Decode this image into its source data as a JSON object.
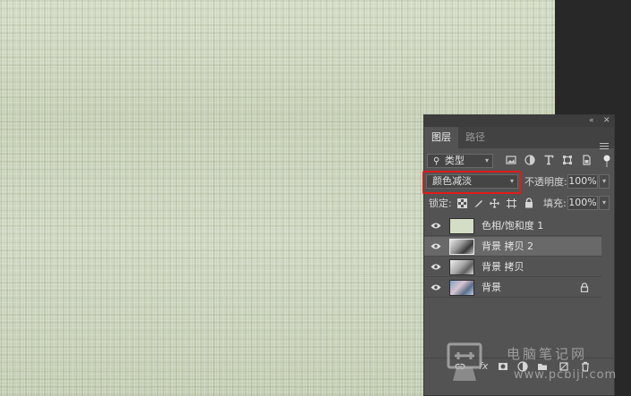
{
  "layers_panel": {
    "tabs": [
      {
        "label": "图层",
        "active": true
      },
      {
        "label": "路径",
        "active": false
      }
    ],
    "filter": {
      "kind_label": "类型"
    },
    "blend_mode": "颜色减淡",
    "opacity": {
      "label": "不透明度:",
      "value": "100%"
    },
    "lock": {
      "label": "锁定:"
    },
    "fill": {
      "label": "填充:",
      "value": "100%"
    },
    "layers": [
      {
        "name": "色相/饱和度 1",
        "visible": true,
        "selected": false,
        "locked": false
      },
      {
        "name": "背景 拷贝 2",
        "visible": true,
        "selected": true,
        "locked": false
      },
      {
        "name": "背景 拷贝",
        "visible": true,
        "selected": false,
        "locked": false
      },
      {
        "name": "背景",
        "visible": true,
        "selected": false,
        "locked": true
      }
    ],
    "bottom_fx": "fx"
  },
  "watermark": {
    "text": "电脑笔记网",
    "url": "www.pcbiji.com"
  },
  "colors": {
    "highlight": "#e11b1b",
    "panel_bg": "#535353",
    "selected_row": "#696969"
  }
}
